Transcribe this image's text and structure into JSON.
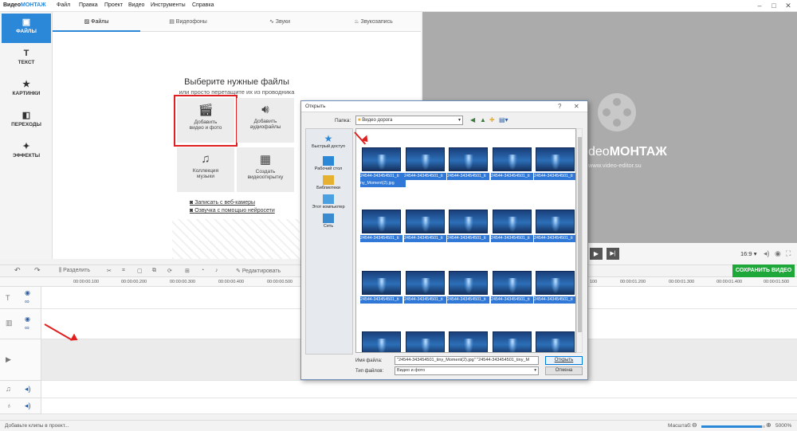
{
  "app": {
    "logo_prefix": "Видео",
    "logo_accent": "МОНТАЖ"
  },
  "menu": [
    "Файл",
    "Правка",
    "Проект",
    "Видео",
    "Инструменты",
    "Справка"
  ],
  "sidebar": [
    {
      "label": "ФАЙЛЫ",
      "icon": "file-icon",
      "active": true
    },
    {
      "label": "ТЕКСТ",
      "icon": "text-icon"
    },
    {
      "label": "КАРТИНКИ",
      "icon": "star-icon"
    },
    {
      "label": "ПЕРЕХОДЫ",
      "icon": "transitions-icon"
    },
    {
      "label": "ЭФФЕКТЫ",
      "icon": "wand-icon"
    }
  ],
  "tabs": [
    {
      "label": "Файлы",
      "icon": "image-icon"
    },
    {
      "label": "Видеофоны",
      "icon": "film-icon"
    },
    {
      "label": "Звуки",
      "icon": "wave-icon"
    },
    {
      "label": "Звукозапись",
      "icon": "mic-icon"
    }
  ],
  "content": {
    "title": "Выберите нужные файлы",
    "subtitle": "или просто перетащите их из проводника",
    "tiles": [
      {
        "label1": "Добавить",
        "label2": "видео и фото"
      },
      {
        "label1": "Добавить",
        "label2": "аудиофайлы"
      },
      {
        "label1": "Коллекция",
        "label2": "музыки"
      },
      {
        "label1": "Создать",
        "label2": "видеооткрытку"
      }
    ],
    "links": [
      "Записать с веб-камеры",
      "Озвучка с помощью нейросети"
    ]
  },
  "preview": {
    "brand_prefix": "deo",
    "brand_accent": "МОНТАЖ",
    "url": "www.video-editor.su",
    "aspect": "16:9"
  },
  "toolbar": {
    "split": "Разделить",
    "edit": "Редактировать",
    "save": "СОХРАНИТЬ ВИДЕО"
  },
  "ruler": {
    "ticks_left": [
      "00:00:00.100",
      "00:00:00.200",
      "00:00:00.300",
      "00:00:00.400",
      "00:00:00.500"
    ],
    "ticks_right": [
      "100",
      "00:00:01.200",
      "00:00:01.300",
      "00:00:01.400",
      "00:00:01.500"
    ]
  },
  "status": {
    "text": "Добавьте клипы в проект...",
    "zoom_label": "Масштаб:",
    "zoom_value": "5000%",
    "zoom_fraction": 0.95
  },
  "dialog": {
    "title": "Открыть",
    "folder_label": "Папка:",
    "folder": "Видео дорога",
    "places": [
      "Быстрый доступ",
      "Рабочий стол",
      "Библиотеки",
      "Этот компьютер",
      "Сеть"
    ],
    "file_label": "24544-343454501_ti",
    "first_selected_label": [
      "24544-343454501_ti",
      "ny_Moment(2).jpg"
    ],
    "filename_label": "Имя файла:",
    "filename_value": "\"24544-343454501_tiny_Moment(2).jpg\" \"24544-343454501_tiny_M",
    "filetype_label": "Тип файлов:",
    "filetype_value": "Видео и фото",
    "open": "Открыть",
    "cancel": "Отмена"
  },
  "colors": {
    "accent": "#2b88d8",
    "brand": "#2b88d8",
    "save": "#1fa83a",
    "highlight": "#e02020"
  }
}
